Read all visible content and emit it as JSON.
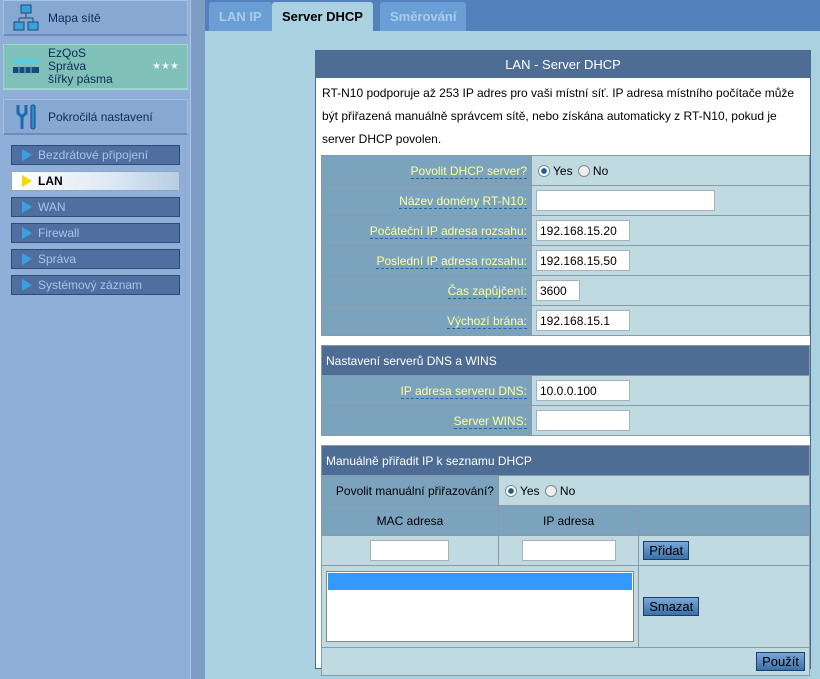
{
  "sidebar": {
    "map": "Mapa sítě",
    "qos_1": "EzQoS",
    "qos_2": "Správa",
    "qos_3": "šířky pásma",
    "advanced": "Pokročilá nastavení",
    "items": [
      {
        "label": "Bezdrátové připojení"
      },
      {
        "label": "LAN"
      },
      {
        "label": "WAN"
      },
      {
        "label": "Firewall"
      },
      {
        "label": "Správa"
      },
      {
        "label": "Systémový záznam"
      }
    ]
  },
  "tabs": [
    {
      "label": "LAN IP"
    },
    {
      "label": "Server DHCP"
    },
    {
      "label": "Směrování"
    }
  ],
  "panel": {
    "title": "LAN - Server DHCP",
    "description": "RT-N10 podporuje až 253 IP adres pro vaši místní síť. IP adresa místního počítače může být přiřazená manuálně správcem sítě, nebo získána automaticky z RT-N10, pokud je server DHCP povolen.",
    "enable_dhcp": "Povolit DHCP server?",
    "yes": "Yes",
    "no": "No",
    "domain": {
      "label": "Název domény RT-N10:",
      "value": ""
    },
    "start_ip": {
      "label": "Počáteční IP adresa rozsahu:",
      "value": "192.168.15.20"
    },
    "end_ip": {
      "label": "Poslední IP adresa rozsahu:",
      "value": "192.168.15.50"
    },
    "lease": {
      "label": "Čas zapůjčení:",
      "value": "3600"
    },
    "gateway": {
      "label": "Výchozí brána:",
      "value": "192.168.15.1"
    },
    "dns_header": "Nastavení serverů DNS a WINS",
    "dns": {
      "label": "IP adresa serveru DNS:",
      "value": "10.0.0.100"
    },
    "wins": {
      "label": "Server WINS:",
      "value": ""
    },
    "manual_header": "Manuálně přiřadit IP k seznamu DHCP",
    "enable_manual": "Povolit manuální přiřazování?",
    "col_mac": "MAC adresa",
    "col_ip": "IP adresa",
    "add": "Přidat",
    "delete": "Smazat",
    "apply": "Použít"
  }
}
